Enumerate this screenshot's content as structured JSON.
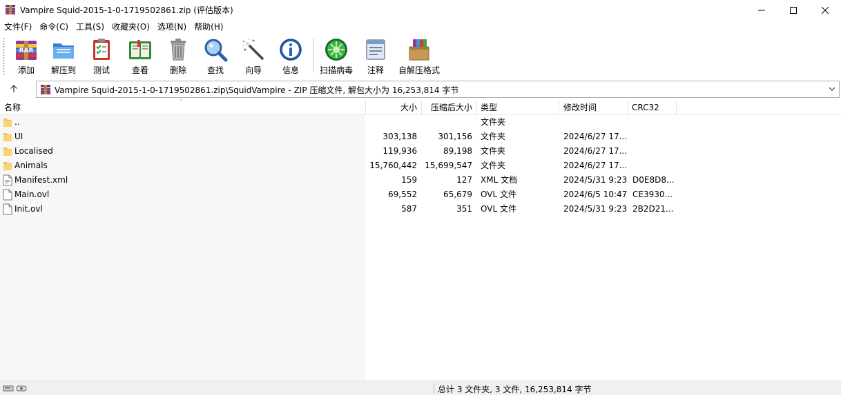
{
  "window": {
    "title": "Vampire Squid-2015-1-0-1719502861.zip (评估版本)"
  },
  "menu": [
    {
      "label": "文件(F)"
    },
    {
      "label": "命令(C)"
    },
    {
      "label": "工具(S)"
    },
    {
      "label": "收藏夹(O)"
    },
    {
      "label": "选项(N)"
    },
    {
      "label": "帮助(H)"
    }
  ],
  "toolbar": {
    "add": "添加",
    "extract": "解压到",
    "test": "测试",
    "view": "查看",
    "delete": "删除",
    "find": "查找",
    "wizard": "向导",
    "info": "信息",
    "virus_scan": "扫描病毒",
    "comment": "注释",
    "sfx": "自解压格式"
  },
  "address": {
    "path": "Vampire Squid-2015-1-0-1719502861.zip\\SquidVampire - ZIP 压缩文件, 解包大小为 16,253,814 字节"
  },
  "columns": {
    "name": "名称",
    "size": "大小",
    "packed": "压缩后大小",
    "type": "类型",
    "modified": "修改时间",
    "crc": "CRC32"
  },
  "files": [
    {
      "name": "..",
      "size": "",
      "packed": "",
      "type": "文件夹",
      "modified": "",
      "crc": "",
      "icon": "folder-icon"
    },
    {
      "name": "UI",
      "size": "303,138",
      "packed": "301,156",
      "type": "文件夹",
      "modified": "2024/6/27 17...",
      "crc": "",
      "icon": "folder-icon"
    },
    {
      "name": "Localised",
      "size": "119,936",
      "packed": "89,198",
      "type": "文件夹",
      "modified": "2024/6/27 17...",
      "crc": "",
      "icon": "folder-icon"
    },
    {
      "name": "Animals",
      "size": "15,760,442",
      "packed": "15,699,547",
      "type": "文件夹",
      "modified": "2024/6/27 17...",
      "crc": "",
      "icon": "folder-icon"
    },
    {
      "name": "Manifest.xml",
      "size": "159",
      "packed": "127",
      "type": "XML 文档",
      "modified": "2024/5/31 9:23",
      "crc": "D0E8D8...",
      "icon": "xml-file-icon"
    },
    {
      "name": "Main.ovl",
      "size": "69,552",
      "packed": "65,679",
      "type": "OVL 文件",
      "modified": "2024/6/5 10:47",
      "crc": "CE3930...",
      "icon": "file-icon"
    },
    {
      "name": "Init.ovl",
      "size": "587",
      "packed": "351",
      "type": "OVL 文件",
      "modified": "2024/5/31 9:23",
      "crc": "2B2D21...",
      "icon": "file-icon"
    }
  ],
  "status": {
    "summary": "总计 3 文件夹, 3 文件, 16,253,814 字节"
  }
}
